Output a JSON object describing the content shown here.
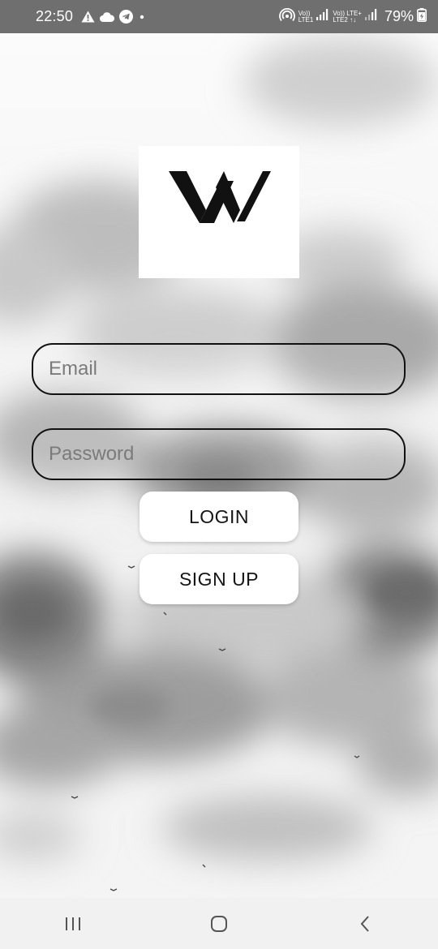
{
  "status_bar": {
    "time": "22:50",
    "network_1": {
      "top": "Vo))",
      "bottom": "LTE1"
    },
    "network_2": {
      "top": "Vo)) LTE+",
      "bottom": "LTE2 ↑↓"
    },
    "battery_percent": "79%",
    "left_icons": [
      "warning-icon",
      "cloud-icon",
      "telegram-icon",
      "dot-icon"
    ],
    "right_icons": [
      "hotspot-icon",
      "signal-icon",
      "battery-charging-icon"
    ]
  },
  "logo": {
    "icon": "w-logo-icon"
  },
  "form": {
    "email_placeholder": "Email",
    "password_placeholder": "Password",
    "login_label": "LOGIN",
    "signup_label": "SIGN UP"
  },
  "nav_bar": {
    "icons": [
      "recents-icon",
      "home-icon",
      "back-icon"
    ]
  },
  "colors": {
    "status_bar_bg": "#6f6f6f",
    "field_border": "#111111",
    "button_bg": "#ffffff",
    "nav_bar_bg": "#f1f1f1"
  }
}
